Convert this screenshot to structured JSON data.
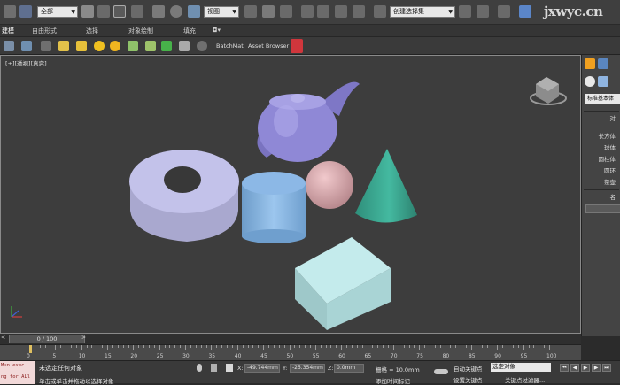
{
  "toolbar": {
    "selection_filter": "全部",
    "ref_coord": "视图",
    "named_selection": "创建选择集",
    "watermark": "jxwyc.cn"
  },
  "tabs": [
    "建模",
    "自由形式",
    "选择",
    "对象绘制",
    "填充"
  ],
  "ribbon": {
    "batchmat": "BatchMat",
    "asset_browser": "Asset Browser"
  },
  "viewport": {
    "label": "[+][透视][真实]"
  },
  "command_panel": {
    "category": "标准基本体",
    "rollout_title": "对",
    "primitives": [
      "长方体",
      "球体",
      "圆柱体",
      "圆环",
      "茶壶"
    ],
    "name_rollout": "名"
  },
  "time": {
    "slider": "0 / 100",
    "ticks": [
      0,
      5,
      10,
      15,
      20,
      25,
      30,
      35,
      40,
      45,
      50,
      55,
      60,
      65,
      70,
      75,
      80,
      85,
      90,
      95,
      100
    ]
  },
  "status": {
    "maxscript_1": "Mun.exec",
    "maxscript_2": "ng for ALl",
    "line1": "未选定任何对象",
    "line2": "单击或单击并拖动以选择对象",
    "x_label": "X:",
    "x_value": "-49.744mm",
    "y_label": "Y:",
    "y_value": "-25.354mm",
    "z_label": "Z:",
    "z_value": "0.0mm",
    "grid": "栅格 = 10.0mm",
    "add_time_tag": "添加时间标记",
    "auto_key": "自动关键点",
    "selected_object": "选定对象",
    "set_key": "设置关键点",
    "key_filters": "关键点过滤器..."
  },
  "colors": {
    "teapot": "#8f88d6",
    "torus": "#b9b8e3",
    "cylinder": "#8ab8e2",
    "sphere": "#d9a9ad",
    "cone": "#3aa993",
    "box": "#b8e3e4"
  }
}
